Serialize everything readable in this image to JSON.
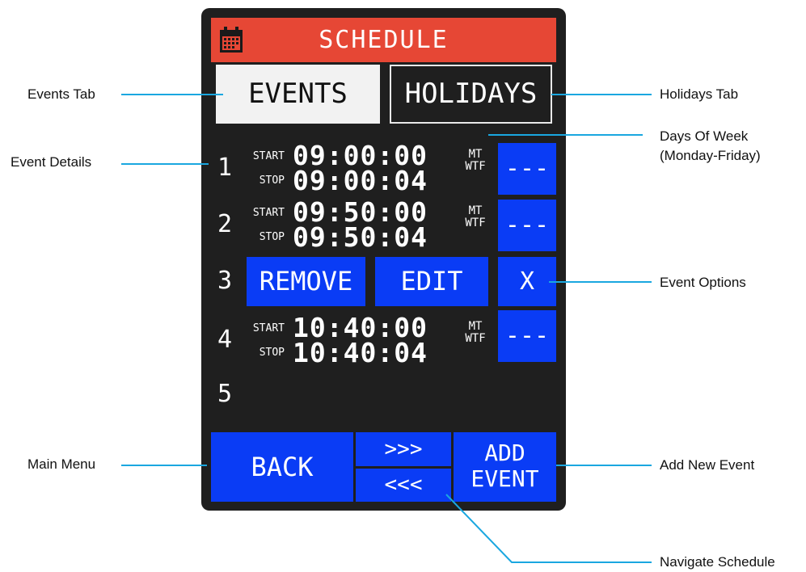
{
  "header": {
    "title": "SCHEDULE",
    "icon": "calendar-icon"
  },
  "tabs": [
    {
      "label": "EVENTS",
      "active": true
    },
    {
      "label": "HOLIDAYS",
      "active": false
    }
  ],
  "labels": {
    "start": "START",
    "stop": "STOP"
  },
  "events": [
    {
      "number": "1",
      "start": "09:00:00",
      "stop": "09:00:04",
      "days_line1": "MT",
      "days_line2": "WTF",
      "days_button": "---"
    },
    {
      "number": "2",
      "start": "09:50:00",
      "stop": "09:50:04",
      "days_line1": "MT",
      "days_line2": "WTF",
      "days_button": "---"
    },
    {
      "number": "3",
      "options": {
        "remove": "REMOVE",
        "edit": "EDIT",
        "close": "X"
      }
    },
    {
      "number": "4",
      "start": "10:40:00",
      "stop": "10:40:04",
      "days_line1": "MT",
      "days_line2": "WTF",
      "days_button": "---"
    },
    {
      "number": "5"
    }
  ],
  "footer": {
    "back": "BACK",
    "next": ">>>",
    "prev": "<<<",
    "add_line1": "ADD",
    "add_line2": "EVENT"
  },
  "callouts": {
    "events_tab": "Events Tab",
    "holidays_tab": "Holidays Tab",
    "event_details": "Event Details",
    "days_of_week_line1": "Days Of Week",
    "days_of_week_line2": "(Monday-Friday)",
    "event_options": "Event Options",
    "main_menu": "Main Menu",
    "add_new_event": "Add New Event",
    "navigate_schedule": "Navigate Schedule"
  },
  "colors": {
    "header": "#e64735",
    "button": "#0a3cf5",
    "screen": "#1f1f1f",
    "callout_line": "#1aa7e0"
  }
}
